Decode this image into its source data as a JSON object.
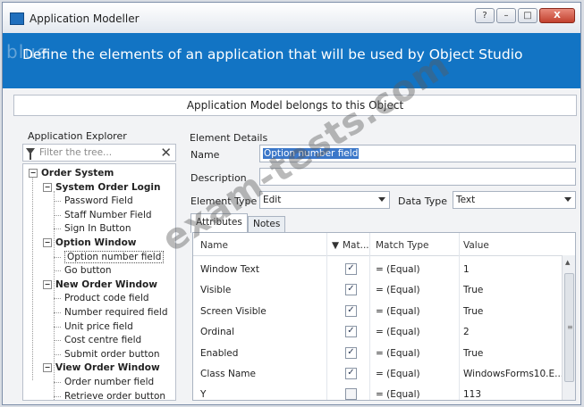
{
  "window": {
    "title": "Application Modeller",
    "help_button": "?",
    "minimize_button": "–",
    "maximize_button": "□",
    "close_button": "X"
  },
  "banner": {
    "brand": "blue",
    "text": "Define the elements of an application that will be used by Object Studio"
  },
  "subheader": "Application Model belongs to this Object",
  "explorer": {
    "label": "Application Explorer",
    "filter_placeholder": "Filter the tree...",
    "clear_icon": "✕",
    "tree": [
      {
        "label": "Order System",
        "level": 0,
        "bold": true,
        "expander": "−"
      },
      {
        "label": "System Order Login",
        "level": 1,
        "bold": true,
        "expander": "−"
      },
      {
        "label": "Password Field",
        "level": 2
      },
      {
        "label": "Staff Number Field",
        "level": 2
      },
      {
        "label": "Sign In Button",
        "level": 2
      },
      {
        "label": "Option Window",
        "level": 1,
        "bold": true,
        "expander": "−"
      },
      {
        "label": "Option number field",
        "level": 2,
        "selected": true
      },
      {
        "label": "Go button",
        "level": 2
      },
      {
        "label": "New Order Window",
        "level": 1,
        "bold": true,
        "expander": "−"
      },
      {
        "label": "Product code field",
        "level": 2
      },
      {
        "label": "Number required field",
        "level": 2
      },
      {
        "label": "Unit price field",
        "level": 2
      },
      {
        "label": "Cost centre field",
        "level": 2
      },
      {
        "label": "Submit order button",
        "level": 2
      },
      {
        "label": "View Order Window",
        "level": 1,
        "bold": true,
        "expander": "−"
      },
      {
        "label": "Order number field",
        "level": 2
      },
      {
        "label": "Retrieve order button",
        "level": 2
      }
    ]
  },
  "details": {
    "title": "Element Details",
    "name_label": "Name",
    "name_value": "Option number field",
    "description_label": "Description",
    "description_value": "",
    "element_type_label": "Element Type",
    "element_type_value": "Edit",
    "data_type_label": "Data Type",
    "data_type_value": "Text"
  },
  "tabs": {
    "attributes": "Attributes",
    "notes": "Notes"
  },
  "grid": {
    "headers": {
      "name": "Name",
      "match": "Mat...",
      "match_type": "Match Type",
      "value": "Value"
    },
    "rows": [
      {
        "name": "Window Text",
        "checked": true,
        "match_type": "=  (Equal)",
        "value": "1"
      },
      {
        "name": "Visible",
        "checked": true,
        "match_type": "=  (Equal)",
        "value": "True"
      },
      {
        "name": "Screen Visible",
        "checked": true,
        "match_type": "=  (Equal)",
        "value": "True"
      },
      {
        "name": "Ordinal",
        "checked": true,
        "match_type": "=  (Equal)",
        "value": "2"
      },
      {
        "name": "Enabled",
        "checked": true,
        "match_type": "=  (Equal)",
        "value": "True"
      },
      {
        "name": "Class Name",
        "checked": true,
        "match_type": "=  (Equal)",
        "value": "WindowsForms10.E..."
      },
      {
        "name": "Y",
        "checked": false,
        "match_type": "=  (Equal)",
        "value": "113"
      }
    ]
  },
  "watermark": "exam-tests.com"
}
